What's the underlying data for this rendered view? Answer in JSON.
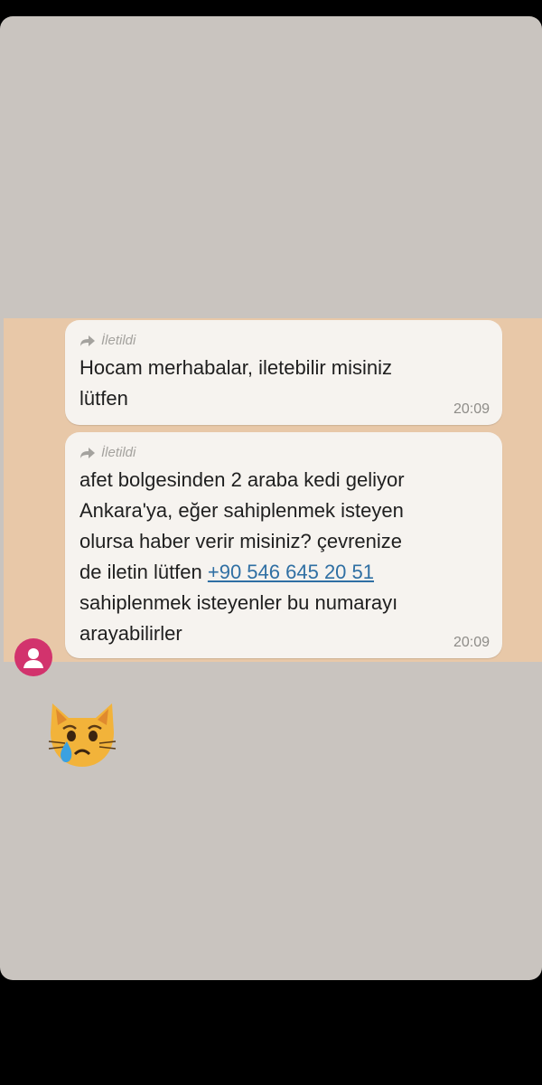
{
  "messages": [
    {
      "forwarded_label": "İletildi",
      "text": "Hocam merhabalar, iletebilir misiniz\nlütfen",
      "time": "20:09"
    },
    {
      "forwarded_label": "İletildi",
      "text_before_link": "afet bolgesinden 2 araba kedi geliyor\nAnkara'ya, eğer sahiplenmek isteyen\nolursa haber verir misiniz? çevrenize\nde iletin lütfen ",
      "phone_link": "+90 546 645 20 51",
      "text_after_link": "\nsahiplenmek isteyenler bu numarayı\narayabilirler",
      "time": "20:09"
    }
  ],
  "sticker": {
    "icon": "crying-cat-face-icon"
  },
  "avatar": {
    "icon": "person-icon",
    "color": "#d2336d"
  },
  "colors": {
    "background": "#c9c4bf",
    "chat_wallpaper": "#e8c8a8",
    "bubble": "#f6f3ef",
    "link": "#2f6fa3"
  }
}
